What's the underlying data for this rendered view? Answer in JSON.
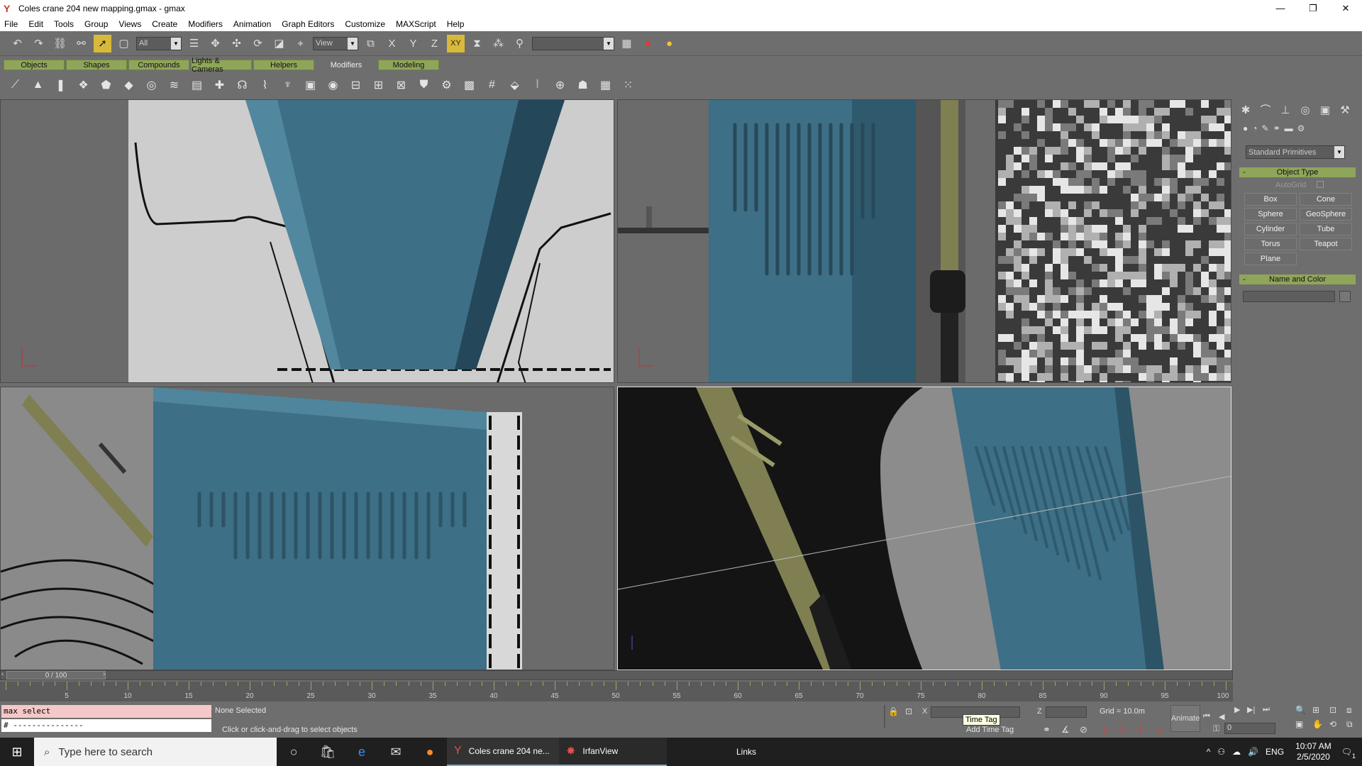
{
  "window": {
    "title": "Coles crane 204 new mapping.gmax - gmax",
    "minimize": "—",
    "maximize": "❐",
    "close": "✕"
  },
  "menu": [
    "File",
    "Edit",
    "Tools",
    "Group",
    "Views",
    "Create",
    "Modifiers",
    "Animation",
    "Graph Editors",
    "Customize",
    "MAXScript",
    "Help"
  ],
  "toolbar": {
    "selection_filter": "All",
    "reference_coord": "View",
    "axis_x": "X",
    "axis_y": "Y",
    "axis_z": "Z",
    "axis_xy": "XY"
  },
  "tabs": [
    "Objects",
    "Shapes",
    "Compounds",
    "Lights & Cameras",
    "Helpers",
    "Modifiers",
    "Modeling"
  ],
  "command_panel": {
    "category_dropdown": "Standard Primitives",
    "object_type_title": "Object Type",
    "autogrid_label": "AutoGrid",
    "buttons": [
      "Box",
      "Cone",
      "Sphere",
      "GeoSphere",
      "Cylinder",
      "Tube",
      "Torus",
      "Teapot",
      "Plane"
    ],
    "name_color_title": "Name and Color",
    "collapse_glyph": "-"
  },
  "timeline": {
    "slider_label": "0 / 100",
    "ticks": [
      "5",
      "10",
      "15",
      "20",
      "25",
      "30",
      "35",
      "40",
      "45",
      "50",
      "55",
      "60",
      "65",
      "70",
      "75",
      "80",
      "85",
      "90",
      "95",
      "100"
    ]
  },
  "status": {
    "maxscript_line1": "max select",
    "maxscript_line2": "# ---------------",
    "selection": "None Selected",
    "prompt": "Click or click-and-drag to select objects",
    "tooltip": "Time Tag",
    "add_time_tag": "Add Time Tag",
    "coord_x_label": "X",
    "coord_z_label": "Z",
    "grid": "Grid = 10.0m",
    "animate": "Animate",
    "frame": "0"
  },
  "taskbar": {
    "search_placeholder": "Type here to search",
    "apps": [
      {
        "label": "Coles crane 204 ne..."
      },
      {
        "label": "IrfanView"
      }
    ],
    "links": "Links",
    "lang": "ENG",
    "time": "10:07 AM",
    "date": "2/5/2020",
    "notif_count": "1"
  },
  "colors": {
    "model_blue": "#3d6f86",
    "tab_green": "#8fa55a",
    "ui_gray": "#6e6e6e",
    "crane_olive": "#8a8a58"
  }
}
